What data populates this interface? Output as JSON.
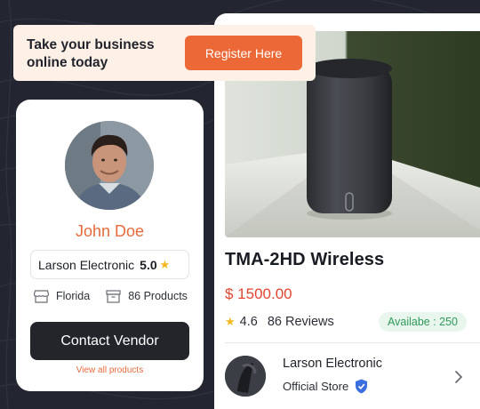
{
  "banner": {
    "text": "Take your business online today",
    "register_label": "Register Here"
  },
  "vendor": {
    "name": "John Doe",
    "store_name": "Larson Electronic",
    "rating": "5.0",
    "location": "Florida",
    "products_count": "86 Products",
    "contact_label": "Contact Vendor",
    "view_all_label": "View all products"
  },
  "product": {
    "title": "TMA-2HD Wireless",
    "price": "$ 1500.00",
    "rating": "4.6",
    "reviews": "86 Reviews",
    "availability": "Availabe : 250",
    "store_name": "Larson Electronic",
    "store_tag": "Official Store"
  },
  "colors": {
    "accent": "#ec6937",
    "background": "#232631",
    "price": "#e2452f",
    "available": "#2f9a5a",
    "verified": "#3b6fe0",
    "star": "#f3b71c"
  },
  "icons": {
    "rating": "star-icon",
    "location": "store-icon",
    "products": "box-icon",
    "verified": "shield-check-icon",
    "next": "chevron-right-icon"
  }
}
